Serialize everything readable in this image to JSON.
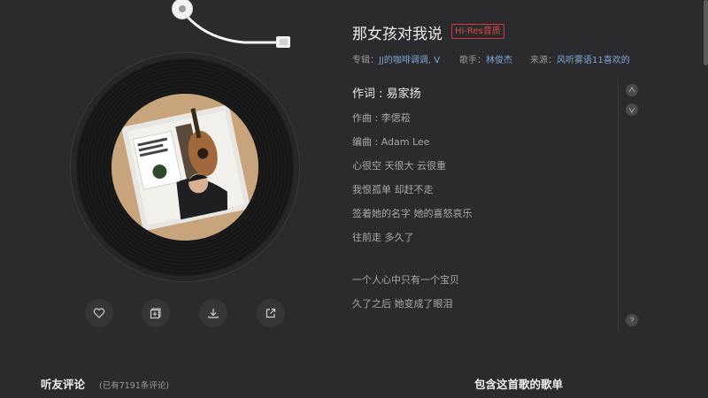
{
  "song": {
    "title": "那女孩对我说",
    "quality_badge": "Hi-Res音质",
    "album_label": "专辑：",
    "album": "JJ的咖啡调调, V",
    "artist_label": "歌手：",
    "artist": "林俊杰",
    "source_label": "来源：",
    "source": "风听雾语11喜欢的"
  },
  "lyrics": [
    "作词 : 易家扬",
    "作曲 : 李偲菘",
    "编曲 : Adam Lee",
    "心很空 天很大 云很重",
    "我恨孤单 却赶不走",
    "签着她的名字 她的喜怒哀乐",
    "往前走 多久了",
    "一个人心中只有一个宝贝",
    "久了之后 她变成了眼泪"
  ],
  "actions": {
    "like": "heart-icon",
    "add": "add-to-playlist-icon",
    "download": "download-icon",
    "share": "share-icon"
  },
  "comments": {
    "title": "听友评论",
    "count": "(已有7191条评论)"
  },
  "playlists": {
    "title": "包含这首歌的歌单"
  },
  "colors": {
    "background": "#2b2b2d",
    "badge_red": "#e24444",
    "link_blue": "#7fa6d6"
  }
}
